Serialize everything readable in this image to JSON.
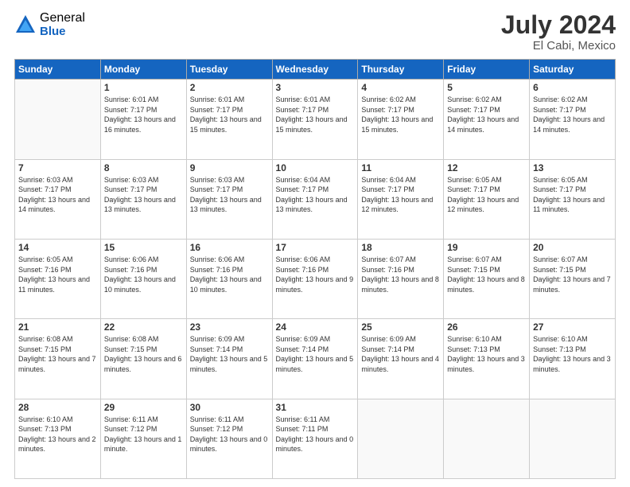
{
  "header": {
    "logo_general": "General",
    "logo_blue": "Blue",
    "title": "July 2024",
    "location": "El Cabi, Mexico"
  },
  "weekdays": [
    "Sunday",
    "Monday",
    "Tuesday",
    "Wednesday",
    "Thursday",
    "Friday",
    "Saturday"
  ],
  "weeks": [
    [
      {
        "day": "",
        "sunrise": "",
        "sunset": "",
        "daylight": ""
      },
      {
        "day": "1",
        "sunrise": "Sunrise: 6:01 AM",
        "sunset": "Sunset: 7:17 PM",
        "daylight": "Daylight: 13 hours and 16 minutes."
      },
      {
        "day": "2",
        "sunrise": "Sunrise: 6:01 AM",
        "sunset": "Sunset: 7:17 PM",
        "daylight": "Daylight: 13 hours and 15 minutes."
      },
      {
        "day": "3",
        "sunrise": "Sunrise: 6:01 AM",
        "sunset": "Sunset: 7:17 PM",
        "daylight": "Daylight: 13 hours and 15 minutes."
      },
      {
        "day": "4",
        "sunrise": "Sunrise: 6:02 AM",
        "sunset": "Sunset: 7:17 PM",
        "daylight": "Daylight: 13 hours and 15 minutes."
      },
      {
        "day": "5",
        "sunrise": "Sunrise: 6:02 AM",
        "sunset": "Sunset: 7:17 PM",
        "daylight": "Daylight: 13 hours and 14 minutes."
      },
      {
        "day": "6",
        "sunrise": "Sunrise: 6:02 AM",
        "sunset": "Sunset: 7:17 PM",
        "daylight": "Daylight: 13 hours and 14 minutes."
      }
    ],
    [
      {
        "day": "7",
        "sunrise": "Sunrise: 6:03 AM",
        "sunset": "Sunset: 7:17 PM",
        "daylight": "Daylight: 13 hours and 14 minutes."
      },
      {
        "day": "8",
        "sunrise": "Sunrise: 6:03 AM",
        "sunset": "Sunset: 7:17 PM",
        "daylight": "Daylight: 13 hours and 13 minutes."
      },
      {
        "day": "9",
        "sunrise": "Sunrise: 6:03 AM",
        "sunset": "Sunset: 7:17 PM",
        "daylight": "Daylight: 13 hours and 13 minutes."
      },
      {
        "day": "10",
        "sunrise": "Sunrise: 6:04 AM",
        "sunset": "Sunset: 7:17 PM",
        "daylight": "Daylight: 13 hours and 13 minutes."
      },
      {
        "day": "11",
        "sunrise": "Sunrise: 6:04 AM",
        "sunset": "Sunset: 7:17 PM",
        "daylight": "Daylight: 13 hours and 12 minutes."
      },
      {
        "day": "12",
        "sunrise": "Sunrise: 6:05 AM",
        "sunset": "Sunset: 7:17 PM",
        "daylight": "Daylight: 13 hours and 12 minutes."
      },
      {
        "day": "13",
        "sunrise": "Sunrise: 6:05 AM",
        "sunset": "Sunset: 7:17 PM",
        "daylight": "Daylight: 13 hours and 11 minutes."
      }
    ],
    [
      {
        "day": "14",
        "sunrise": "Sunrise: 6:05 AM",
        "sunset": "Sunset: 7:16 PM",
        "daylight": "Daylight: 13 hours and 11 minutes."
      },
      {
        "day": "15",
        "sunrise": "Sunrise: 6:06 AM",
        "sunset": "Sunset: 7:16 PM",
        "daylight": "Daylight: 13 hours and 10 minutes."
      },
      {
        "day": "16",
        "sunrise": "Sunrise: 6:06 AM",
        "sunset": "Sunset: 7:16 PM",
        "daylight": "Daylight: 13 hours and 10 minutes."
      },
      {
        "day": "17",
        "sunrise": "Sunrise: 6:06 AM",
        "sunset": "Sunset: 7:16 PM",
        "daylight": "Daylight: 13 hours and 9 minutes."
      },
      {
        "day": "18",
        "sunrise": "Sunrise: 6:07 AM",
        "sunset": "Sunset: 7:16 PM",
        "daylight": "Daylight: 13 hours and 8 minutes."
      },
      {
        "day": "19",
        "sunrise": "Sunrise: 6:07 AM",
        "sunset": "Sunset: 7:15 PM",
        "daylight": "Daylight: 13 hours and 8 minutes."
      },
      {
        "day": "20",
        "sunrise": "Sunrise: 6:07 AM",
        "sunset": "Sunset: 7:15 PM",
        "daylight": "Daylight: 13 hours and 7 minutes."
      }
    ],
    [
      {
        "day": "21",
        "sunrise": "Sunrise: 6:08 AM",
        "sunset": "Sunset: 7:15 PM",
        "daylight": "Daylight: 13 hours and 7 minutes."
      },
      {
        "day": "22",
        "sunrise": "Sunrise: 6:08 AM",
        "sunset": "Sunset: 7:15 PM",
        "daylight": "Daylight: 13 hours and 6 minutes."
      },
      {
        "day": "23",
        "sunrise": "Sunrise: 6:09 AM",
        "sunset": "Sunset: 7:14 PM",
        "daylight": "Daylight: 13 hours and 5 minutes."
      },
      {
        "day": "24",
        "sunrise": "Sunrise: 6:09 AM",
        "sunset": "Sunset: 7:14 PM",
        "daylight": "Daylight: 13 hours and 5 minutes."
      },
      {
        "day": "25",
        "sunrise": "Sunrise: 6:09 AM",
        "sunset": "Sunset: 7:14 PM",
        "daylight": "Daylight: 13 hours and 4 minutes."
      },
      {
        "day": "26",
        "sunrise": "Sunrise: 6:10 AM",
        "sunset": "Sunset: 7:13 PM",
        "daylight": "Daylight: 13 hours and 3 minutes."
      },
      {
        "day": "27",
        "sunrise": "Sunrise: 6:10 AM",
        "sunset": "Sunset: 7:13 PM",
        "daylight": "Daylight: 13 hours and 3 minutes."
      }
    ],
    [
      {
        "day": "28",
        "sunrise": "Sunrise: 6:10 AM",
        "sunset": "Sunset: 7:13 PM",
        "daylight": "Daylight: 13 hours and 2 minutes."
      },
      {
        "day": "29",
        "sunrise": "Sunrise: 6:11 AM",
        "sunset": "Sunset: 7:12 PM",
        "daylight": "Daylight: 13 hours and 1 minute."
      },
      {
        "day": "30",
        "sunrise": "Sunrise: 6:11 AM",
        "sunset": "Sunset: 7:12 PM",
        "daylight": "Daylight: 13 hours and 0 minutes."
      },
      {
        "day": "31",
        "sunrise": "Sunrise: 6:11 AM",
        "sunset": "Sunset: 7:11 PM",
        "daylight": "Daylight: 13 hours and 0 minutes."
      },
      {
        "day": "",
        "sunrise": "",
        "sunset": "",
        "daylight": ""
      },
      {
        "day": "",
        "sunrise": "",
        "sunset": "",
        "daylight": ""
      },
      {
        "day": "",
        "sunrise": "",
        "sunset": "",
        "daylight": ""
      }
    ]
  ]
}
